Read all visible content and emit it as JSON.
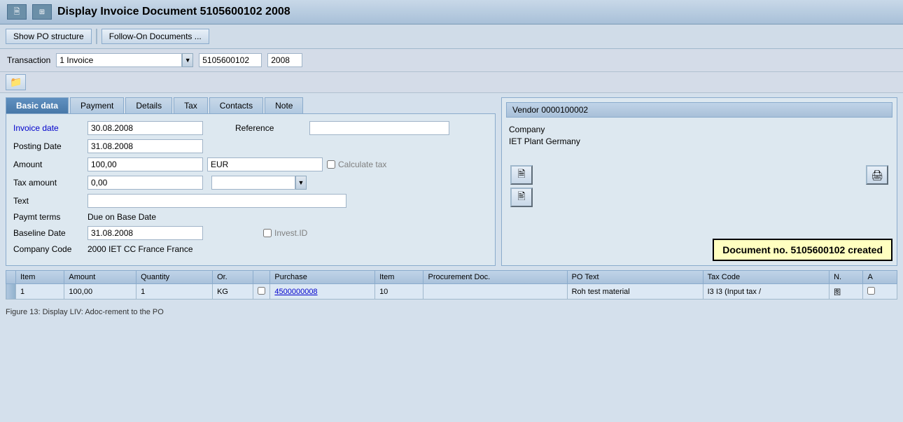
{
  "titleBar": {
    "title": "Display Invoice Document 5105600102 2008",
    "icons": [
      "grid-icon",
      "page-icon"
    ]
  },
  "toolbar": {
    "buttons": [
      "Show PO structure",
      "Follow-On Documents ..."
    ]
  },
  "transactionRow": {
    "label": "Transaction",
    "value": "1 Invoice",
    "doc_number": "5105600102",
    "doc_year": "2008"
  },
  "tabs": [
    {
      "label": "Basic data",
      "active": true
    },
    {
      "label": "Payment",
      "active": false
    },
    {
      "label": "Details",
      "active": false
    },
    {
      "label": "Tax",
      "active": false
    },
    {
      "label": "Contacts",
      "active": false
    },
    {
      "label": "Note",
      "active": false
    }
  ],
  "form": {
    "invoice_date_label": "Invoice date",
    "invoice_date_value": "30.08.2008",
    "reference_label": "Reference",
    "reference_value": "",
    "posting_date_label": "Posting Date",
    "posting_date_value": "31.08.2008",
    "amount_label": "Amount",
    "amount_value": "100,00",
    "currency": "EUR",
    "calculate_tax_label": "Calculate tax",
    "tax_amount_label": "Tax amount",
    "tax_amount_value": "0,00",
    "text_label": "Text",
    "text_value": "",
    "paymt_terms_label": "Paymt terms",
    "paymt_terms_value": "Due on Base Date",
    "baseline_date_label": "Baseline Date",
    "baseline_date_value": "31.08.2008",
    "invest_id_label": "Invest.ID",
    "company_code_label": "Company Code",
    "company_code_value": "2000 IET CC France France"
  },
  "vendor": {
    "header": "Vendor 0000100002",
    "company_label": "Company",
    "company_value": "IET Plant Germany"
  },
  "docCreated": {
    "message": "Document no. 5105600102 created"
  },
  "table": {
    "headers": [
      "Item",
      "Amount",
      "Quantity",
      "Or.",
      "",
      "Purchase",
      "Item",
      "Procurement Doc.",
      "PO Text",
      "Tax Code",
      "N.",
      "A"
    ],
    "rows": [
      {
        "selector": "",
        "item": "1",
        "amount": "100,00",
        "quantity": "1",
        "unit": "KG",
        "checkbox": "",
        "purchase": "4500000008",
        "item2": "10",
        "procurement": "",
        "po_text": "Roh test material",
        "tax_code": "I3  I3 (Input tax /",
        "n": "图",
        "a": ""
      }
    ]
  },
  "caption": "Figure 13: Display LIV: Adoc-rement to the PO"
}
